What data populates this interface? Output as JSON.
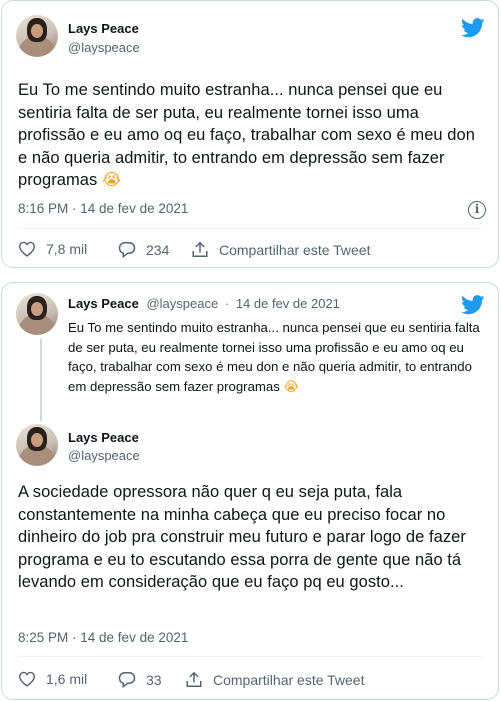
{
  "tweet1": {
    "name": "Lays Peace",
    "handle": "@layspeace",
    "text": "Eu To me sentindo muito estranha... nunca pensei que eu sentiria falta de ser puta, eu realmente tornei isso uma profissão e eu amo oq eu faço, trabalhar com sexo é meu don e não queria admitir, to entrando em depressão sem fazer programas",
    "emoji": "😭",
    "timestamp": "8:16 PM · 14 de fev de 2021",
    "likes": "7,8 mil",
    "replies": "234",
    "share_label": "Compartilhar este Tweet"
  },
  "tweet2": {
    "quoted": {
      "name": "Lays Peace",
      "handle": "@layspeace",
      "sep": "·",
      "date": "14 de fev de 2021",
      "text": "Eu To me sentindo muito estranha... nunca pensei que eu sentiria falta de ser puta, eu realmente tornei isso uma profissão e eu amo oq eu faço, trabalhar com sexo é meu don e não queria admitir, to entrando em depressão sem fazer programas",
      "emoji": "😭"
    },
    "name": "Lays Peace",
    "handle": "@layspeace",
    "text": "A sociedade opressora não quer q eu seja puta, fala constantemente na minha cabeça que eu preciso focar no dinheiro do job pra construir meu futuro e parar logo de fazer programa e eu to escutando essa porra de gente que não tá levando em consideração que eu faço pq eu gosto...",
    "timestamp": "8:25 PM · 14 de fev de 2021",
    "likes": "1,6 mil",
    "replies": "33",
    "share_label": "Compartilhar este Tweet"
  },
  "colors": {
    "twitter_blue": "#1d9bf0",
    "text": "#0f1419",
    "muted": "#536471",
    "border": "#cfd9de"
  },
  "icons": [
    "twitter-bird-icon",
    "heart-icon",
    "reply-icon",
    "share-icon",
    "info-icon",
    "avatar"
  ]
}
